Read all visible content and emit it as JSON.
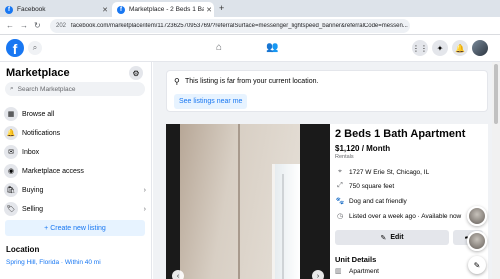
{
  "browser": {
    "tabs": [
      {
        "title": "Facebook",
        "favicon": "f"
      },
      {
        "title": "Marketplace - 2 Beds 1 Bath Ap",
        "favicon": "f"
      }
    ],
    "new_tab": "+",
    "site_info": "202",
    "url": "facebook.com/marketplace/item/1172362570953769/?referralSurface=messenger_lightspeed_banner&referralCode=messen..."
  },
  "fb": {
    "logo": "f"
  },
  "sidebar": {
    "title": "Marketplace",
    "search_placeholder": "Search Marketplace",
    "items": [
      {
        "label": "Browse all",
        "icon": "store-icon",
        "glyph": "▦",
        "chevron": ""
      },
      {
        "label": "Notifications",
        "icon": "bell-icon",
        "glyph": "🔔",
        "chevron": ""
      },
      {
        "label": "Inbox",
        "icon": "inbox-icon",
        "glyph": "✉",
        "chevron": ""
      },
      {
        "label": "Marketplace access",
        "icon": "access-icon",
        "glyph": "◉",
        "chevron": ""
      },
      {
        "label": "Buying",
        "icon": "bag-icon",
        "glyph": "🛍",
        "chevron": "›"
      },
      {
        "label": "Selling",
        "icon": "tag-icon",
        "glyph": "🏷",
        "chevron": "›"
      }
    ],
    "create_button": "+ Create new listing",
    "location_heading": "Location",
    "location_value": "Spring Hill, Florida · Within 40 mi"
  },
  "notice": {
    "text": "This listing is far from your current location.",
    "button": "See listings near me"
  },
  "listing": {
    "title": "2 Beds 1 Bath Apartment",
    "price": "$1,120 / Month",
    "category": "Rentals",
    "details": [
      {
        "icon": "pin-icon",
        "glyph": "⌖",
        "text": "1727 W Erie St, Chicago, IL"
      },
      {
        "icon": "size-icon",
        "glyph": "⤢",
        "text": "750 square feet"
      },
      {
        "icon": "pet-icon",
        "glyph": "🐾",
        "text": "Dog and cat friendly"
      },
      {
        "icon": "clock-icon",
        "glyph": "◷",
        "text": "Listed over a week ago · Available now"
      }
    ],
    "edit_button": "Edit",
    "unit_heading": "Unit Details",
    "unit_type": "Apartment"
  },
  "colors": {
    "accent": "#1877f2",
    "page_bg": "#f0f2f5"
  }
}
